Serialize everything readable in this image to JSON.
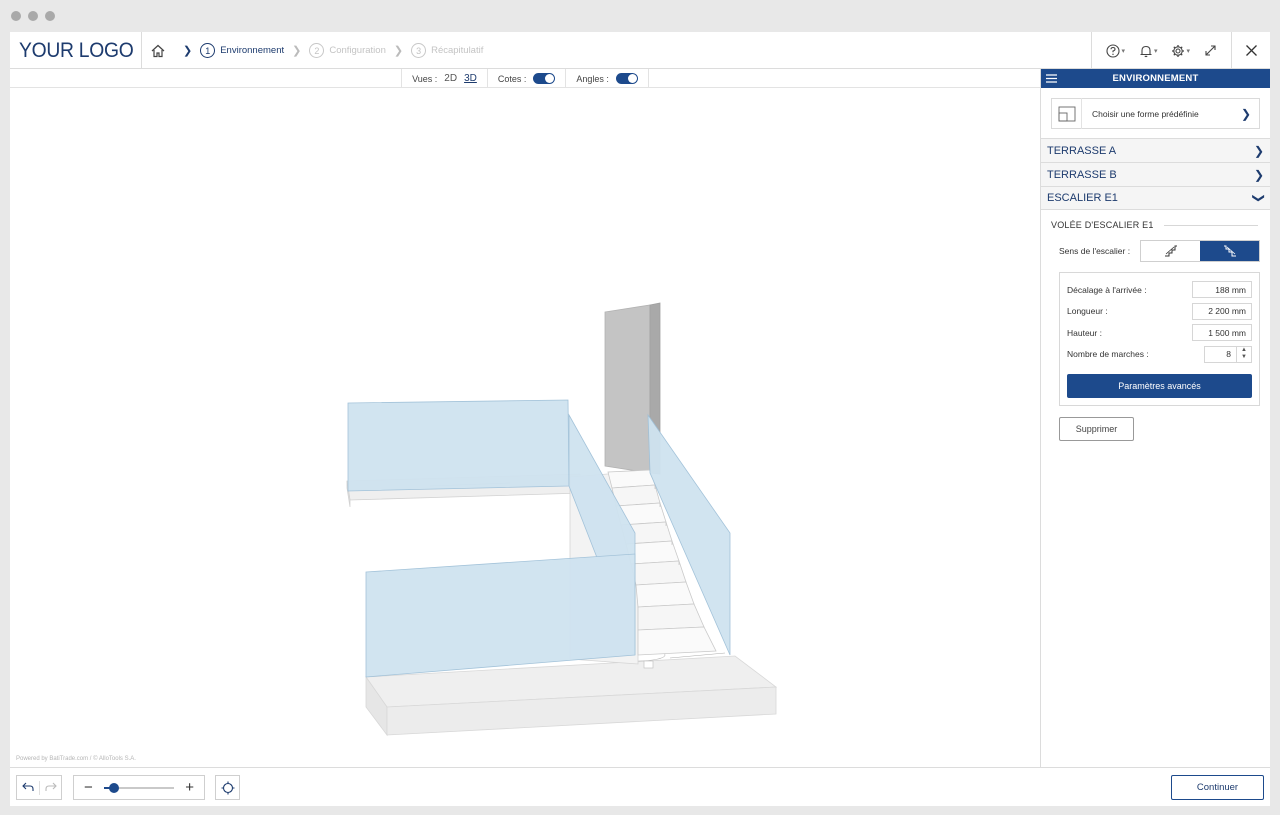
{
  "app": {
    "logo_text": "YOUR LOGO"
  },
  "breadcrumb": {
    "steps": [
      {
        "num": "1",
        "label": "Environnement",
        "state": "active"
      },
      {
        "num": "2",
        "label": "Configuration",
        "state": "inactive"
      },
      {
        "num": "3",
        "label": "Récapitulatif",
        "state": "inactive"
      }
    ]
  },
  "header_icons": [
    "home-icon",
    "help-icon",
    "bell-icon",
    "gear-icon",
    "expand-icon",
    "close-icon"
  ],
  "toolbar": {
    "vues_label": "Vues :",
    "view_2d": "2D",
    "view_3d": "3D",
    "selected_view": "3D",
    "cotes_label": "Cotes :",
    "cotes_on": true,
    "angles_label": "Angles :",
    "angles_on": true
  },
  "viewport": {
    "powered_text": "Powered by BatiTrade.com / © AlloTools S.A."
  },
  "panel": {
    "title": "ENVIRONNEMENT",
    "preset_label": "Choisir une forme prédéfinie",
    "sections": [
      {
        "label": "TERRASSE A",
        "expanded": false
      },
      {
        "label": "TERRASSE B",
        "expanded": false
      },
      {
        "label": "ESCALIER E1",
        "expanded": true
      }
    ],
    "flight_title": "VOLÉE D'ESCALIER E1",
    "sens_label": "Sens de l'escalier :",
    "sens_selected": "right",
    "params": {
      "decalage_label": "Décalage à l'arrivée :",
      "decalage_value": "188 mm",
      "longueur_label": "Longueur :",
      "longueur_value": "2 200 mm",
      "hauteur_label": "Hauteur :",
      "hauteur_value": "1 500 mm",
      "marches_label": "Nombre de marches :",
      "marches_value": "8"
    },
    "advanced_label": "Paramètres avancés",
    "delete_label": "Supprimer"
  },
  "bottombar": {
    "zoom_level": 0.14,
    "continue_label": "Continuer"
  },
  "colors": {
    "brand": "#1d4a8c",
    "brand_dark": "#1d3b6e",
    "glass": "#cfe3f0"
  }
}
